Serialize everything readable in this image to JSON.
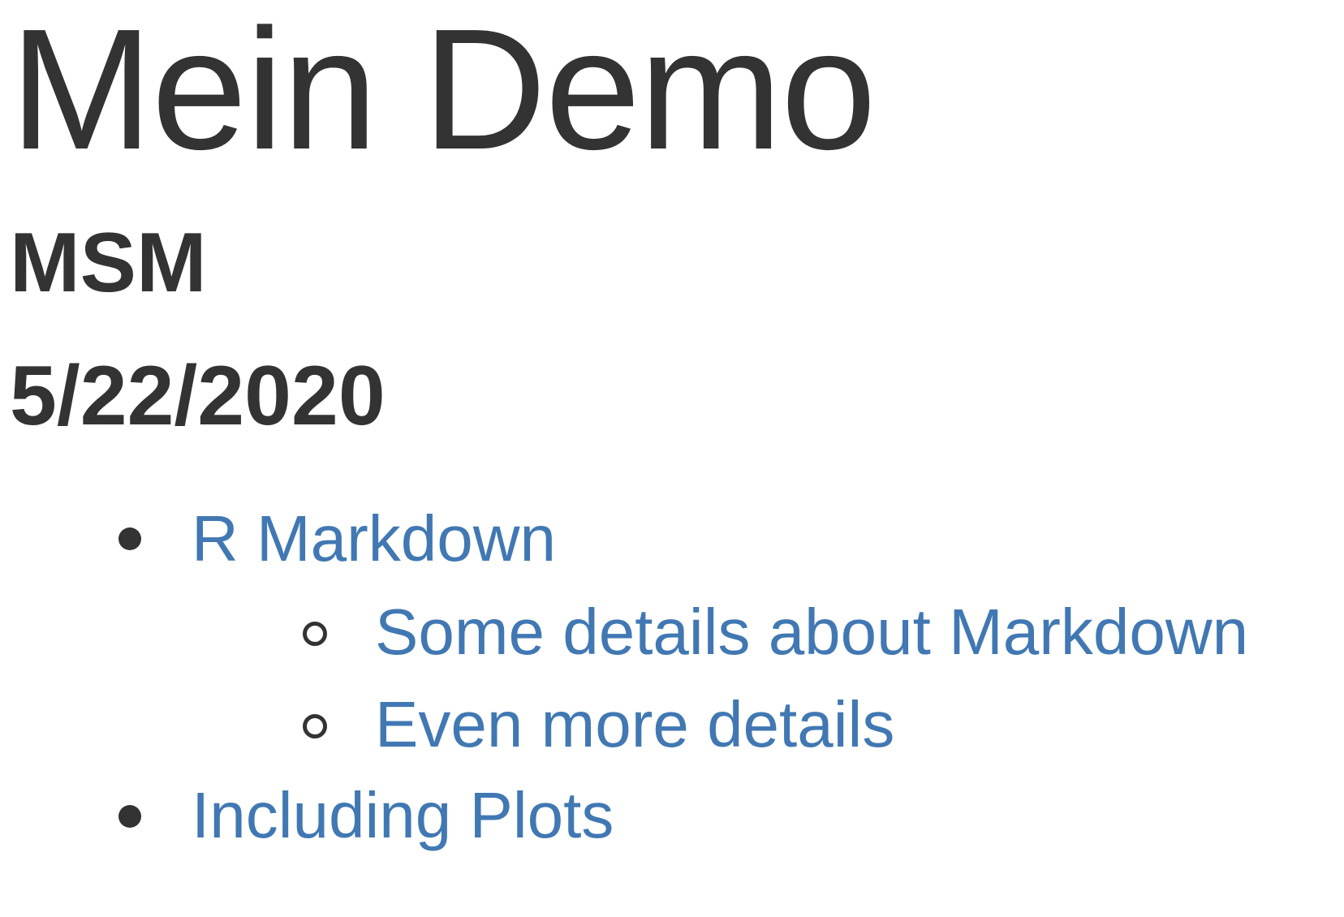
{
  "header": {
    "title": "Mein Demo",
    "author": "MSM",
    "date": "5/22/2020"
  },
  "toc": {
    "items": [
      {
        "label": "R Markdown",
        "children": [
          {
            "label": "Some details about Markdown"
          },
          {
            "label": "Even more details"
          }
        ]
      },
      {
        "label": "Including Plots",
        "children": []
      }
    ]
  },
  "colors": {
    "text": "#333333",
    "link": "#4178b3",
    "background": "#ffffff"
  }
}
